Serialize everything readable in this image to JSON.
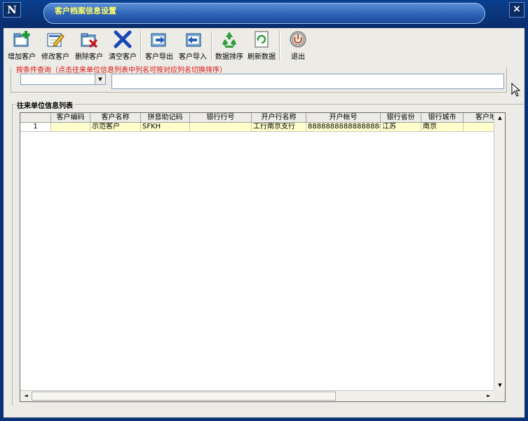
{
  "window": {
    "title": "客户档案信息设置",
    "logo": "N",
    "close_glyph": "×"
  },
  "toolbar": {
    "buttons": [
      {
        "label": "增加客户",
        "icon": "add-folder-icon"
      },
      {
        "label": "修改客户",
        "icon": "edit-icon"
      },
      {
        "label": "删除客户",
        "icon": "delete-folder-icon"
      },
      {
        "label": "清空客户",
        "icon": "clear-x-icon"
      },
      {
        "label": "客户导出",
        "icon": "export-icon"
      },
      {
        "label": "客户导入",
        "icon": "import-icon"
      },
      {
        "label": "数据排序",
        "icon": "recycle-sort-icon"
      },
      {
        "label": "刷新数据",
        "icon": "refresh-icon"
      },
      {
        "label": "退出",
        "icon": "exit-power-icon"
      }
    ]
  },
  "query": {
    "legend": "按条件查询（点击往来单位信息列表中列名可按对应列名切换排序）",
    "combo_value": "",
    "combo_arrow": "▼",
    "input_value": ""
  },
  "list": {
    "title": "往来单位信息列表",
    "columns": [
      "",
      "客户编码",
      "客户名称",
      "拼音助记码",
      "银行行号",
      "开户行名称",
      "开户帐号",
      "银行省份",
      "银行城市",
      "客户地"
    ],
    "rows": [
      {
        "num": "1",
        "code": "",
        "name": "示范客户",
        "pinyin": "SFKH",
        "bank_no": "",
        "bank_name": "工行南京支行",
        "account": "888888888888888888",
        "province": "江苏",
        "city": "南京",
        "address": ""
      }
    ]
  },
  "scroll": {
    "up": "▲",
    "down": "▼",
    "left": "◄",
    "right": "►"
  }
}
